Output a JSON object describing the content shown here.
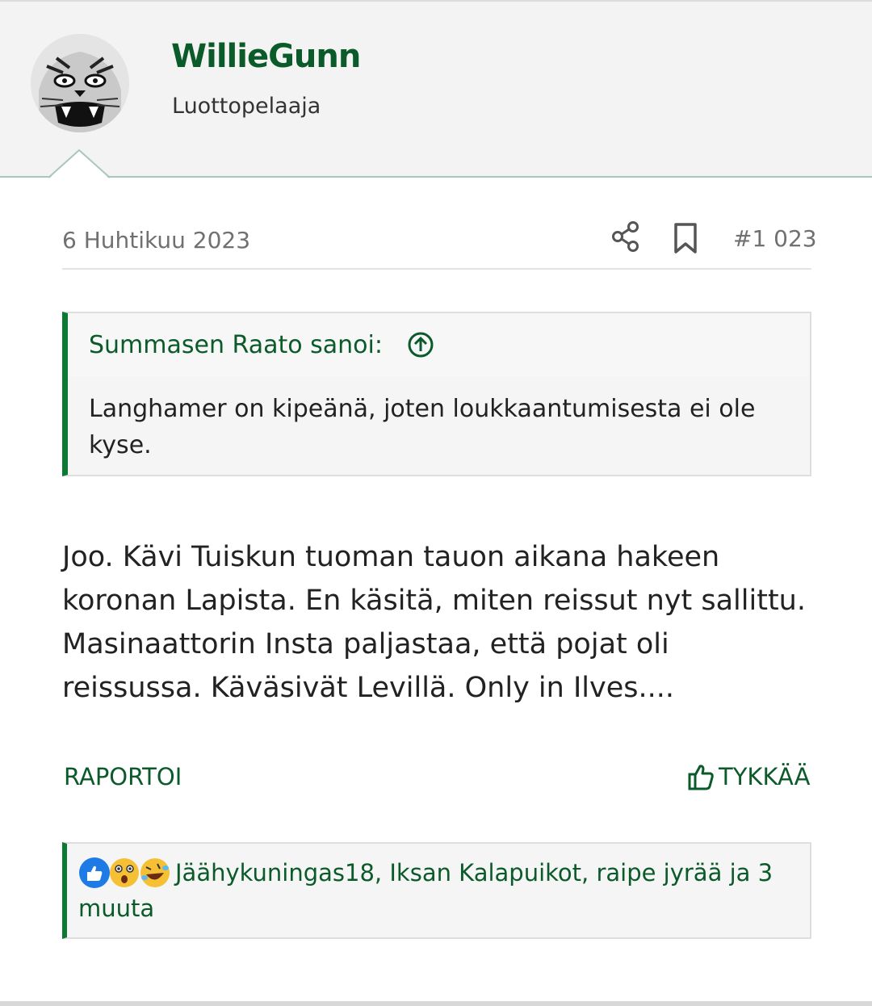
{
  "user": {
    "name": "WillieGunn",
    "title": "Luottopelaaja",
    "avatar_icon": "lynx-avatar"
  },
  "post": {
    "date": "6 Huhtikuu 2023",
    "number": "#1 023",
    "body": "Joo. Kävi Tuiskun tuoman tauon aikana hakeen koronan Lapista. En käsitä, miten reissut nyt sallittu. Masinaattorin Insta paljastaa, että pojat oli reissussa. Käväsivät Levillä. Only in Ilves...."
  },
  "quote": {
    "author": "Summasen Raato sanoi:",
    "text": "Langhamer on kipeänä, joten loukkaantumisesta ei ole kyse."
  },
  "actions": {
    "report_label": "RAPORTOI",
    "like_label": "TYKKÄÄ"
  },
  "reactions": {
    "icons": [
      "like-icon",
      "wow-icon",
      "haha-icon"
    ],
    "line1": "Jäähykuningas18, Iksan Kalapuikot, raipe jyrää ja 3",
    "line2": "muuta"
  },
  "colors": {
    "brand_green": "#0b5a2a",
    "accent_green": "#0b7a35",
    "header_bg": "#f3f3f3"
  }
}
